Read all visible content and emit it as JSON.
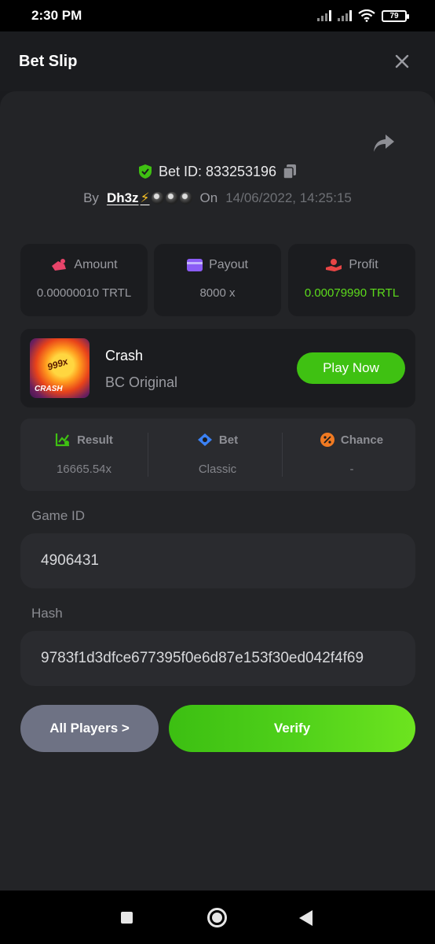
{
  "status_bar": {
    "time": "2:30 PM",
    "battery": "79"
  },
  "header": {
    "title": "Bet Slip"
  },
  "bet": {
    "id_label": "Bet ID: 833253196",
    "by_label": "By",
    "user": "Dh3z",
    "on_label": "On",
    "date": "14/06/2022, 14:25:15"
  },
  "stats": [
    {
      "label": "Amount",
      "value": "0.00000010 TRTL",
      "icon": "amount-icon",
      "color": "#e8446a"
    },
    {
      "label": "Payout",
      "value": "8000 x",
      "icon": "wallet-icon",
      "color": "#8b5cf6"
    },
    {
      "label": "Profit",
      "value": "0.00079990 TRTL",
      "icon": "profit-icon",
      "color": "#e84545"
    }
  ],
  "game": {
    "name": "Crash",
    "subtitle": "BC Original",
    "thumb_multiplier": "999x",
    "thumb_label": "CRASH",
    "play_label": "Play Now"
  },
  "result": [
    {
      "label": "Result",
      "value": "16665.54x",
      "icon": "chart-icon",
      "color": "#3fc112"
    },
    {
      "label": "Bet",
      "value": "Classic",
      "icon": "ticket-icon",
      "color": "#3b82f6"
    },
    {
      "label": "Chance",
      "value": "-",
      "icon": "percent-icon",
      "color": "#f07a22"
    }
  ],
  "fields": {
    "game_id_label": "Game ID",
    "game_id": "4906431",
    "hash_label": "Hash",
    "hash": "9783f1d3dfce677395f0e6d87e153f30ed042f4f69"
  },
  "actions": {
    "all_players": "All Players >",
    "verify": "Verify"
  },
  "colors": {
    "accent_green": "#3fc112",
    "profit_green": "#5ddb1c",
    "panel": "#232427"
  }
}
